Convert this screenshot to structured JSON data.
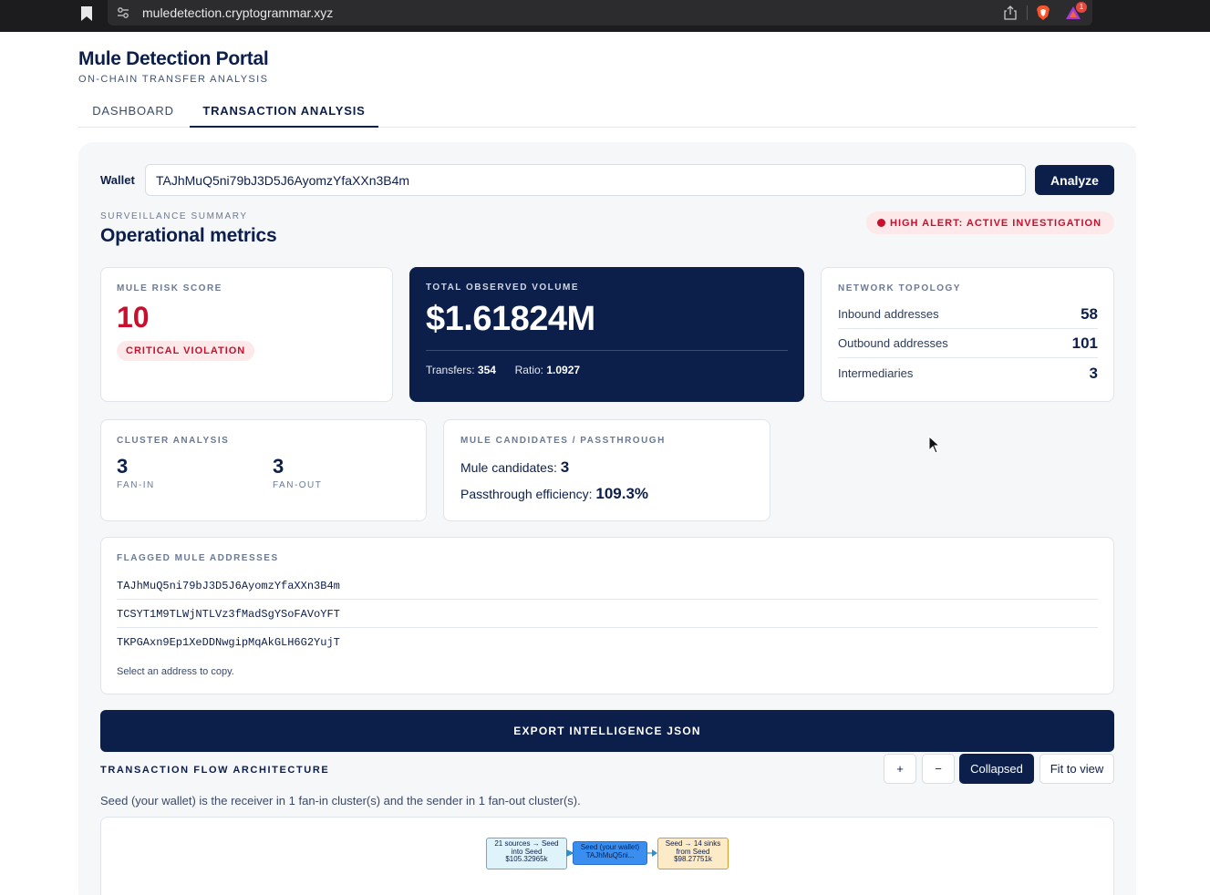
{
  "browser": {
    "url": "muledetection.cryptogrammar.xyz",
    "notification_count": "1"
  },
  "header": {
    "title": "Mule Detection Portal",
    "subtitle": "ON-CHAIN TRANSFER ANALYSIS"
  },
  "tabs": [
    {
      "label": "DASHBOARD",
      "active": false
    },
    {
      "label": "TRANSACTION ANALYSIS",
      "active": true
    }
  ],
  "wallet": {
    "label": "Wallet",
    "value": "TAJhMuQ5ni79bJ3D5J6AyomzYfaXXn3B4m",
    "analyze_label": "Analyze"
  },
  "summary": {
    "eyebrow": "SURVEILLANCE SUMMARY",
    "title": "Operational metrics",
    "alert": "HIGH ALERT: ACTIVE INVESTIGATION",
    "alert_color": "#c8102e"
  },
  "risk": {
    "label": "MULE RISK SCORE",
    "value": "10",
    "badge": "CRITICAL VIOLATION"
  },
  "volume": {
    "label": "TOTAL OBSERVED VOLUME",
    "value": "$1.61824M",
    "transfers_label": "Transfers:",
    "transfers": "354",
    "ratio_label": "Ratio:",
    "ratio": "1.0927"
  },
  "topology": {
    "label": "NETWORK TOPOLOGY",
    "rows": [
      {
        "name": "Inbound addresses",
        "value": "58"
      },
      {
        "name": "Outbound addresses",
        "value": "101"
      },
      {
        "name": "Intermediaries",
        "value": "3"
      }
    ]
  },
  "cluster": {
    "label": "CLUSTER ANALYSIS",
    "fan_in": "3",
    "fan_in_label": "FAN-IN",
    "fan_out": "3",
    "fan_out_label": "FAN-OUT"
  },
  "mule": {
    "label": "MULE CANDIDATES / PASSTHROUGH",
    "candidates_label": "Mule candidates:",
    "candidates": "3",
    "efficiency_label": "Passthrough efficiency:",
    "efficiency": "109.3%"
  },
  "flagged": {
    "label": "FLAGGED MULE ADDRESSES",
    "addresses": [
      "TAJhMuQ5ni79bJ3D5J6AyomzYfaXXn3B4m",
      "TCSYT1M9TLWjNTLVz3fMadSgYSoFAVoYFT",
      "TKPGAxn9Ep1XeDDNwgipMqAkGLH6G2YujT"
    ],
    "hint": "Select an address to copy."
  },
  "export_label": "EXPORT INTELLIGENCE JSON",
  "flow": {
    "title": "TRANSACTION FLOW ARCHITECTURE",
    "zoom_in": "+",
    "zoom_out": "−",
    "collapsed": "Collapsed",
    "fit": "Fit to view",
    "description": "Seed (your wallet) is the receiver in 1 fan-in cluster(s) and the sender in 1 fan-out cluster(s).",
    "nodes": {
      "source": [
        "21 sources → Seed",
        "into Seed",
        "$105.32965k"
      ],
      "seed": [
        "Seed (your wallet)",
        "TAJhMuQ5ni..."
      ],
      "sink": [
        "Seed → 14 sinks",
        "from Seed",
        "$98.27751k"
      ]
    }
  },
  "icons": {
    "bookmark": "bookmark-icon",
    "site": "site-settings-icon",
    "share": "share-icon",
    "brave": "brave-shield-icon",
    "rewards": "brave-rewards-icon",
    "cursor": "mouse-cursor-icon"
  }
}
